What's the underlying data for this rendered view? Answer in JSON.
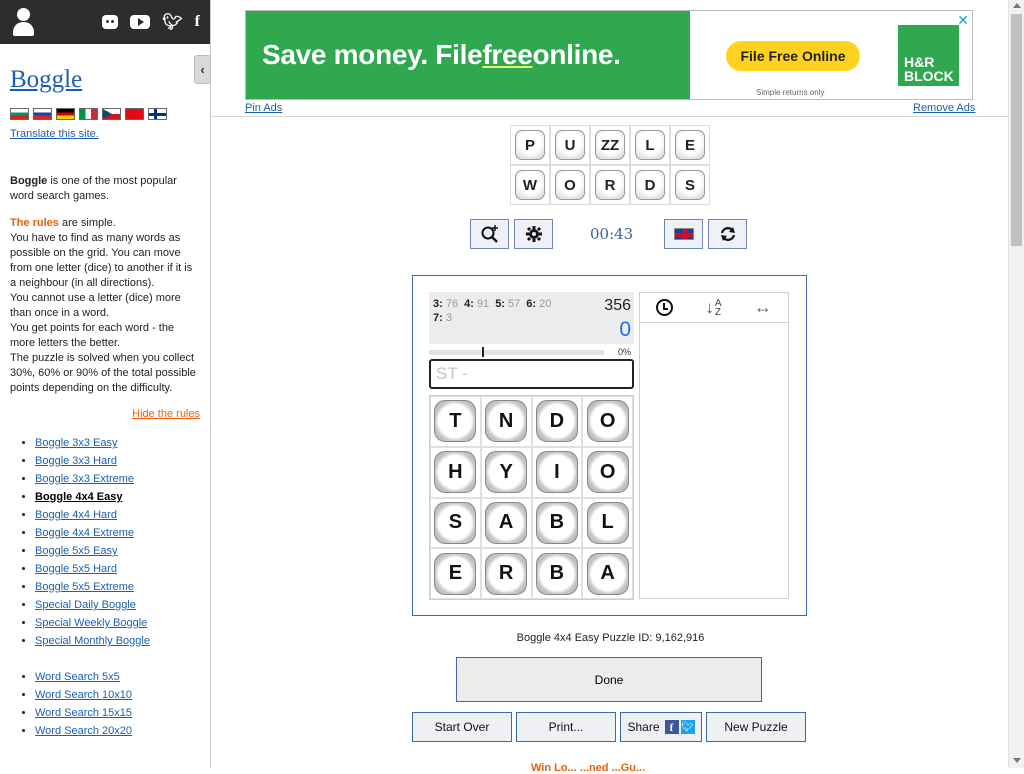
{
  "sidebar": {
    "social": [
      "user-icon",
      "discord-icon",
      "youtube-icon",
      "twitter-icon",
      "facebook-icon"
    ],
    "site_title": "Boggle",
    "flags": [
      "bg",
      "ru",
      "de",
      "it",
      "cz",
      "tr",
      "fi"
    ],
    "translate_link": "Translate this site.",
    "intro_bold": "Boggle",
    "intro_text": " is one of the most popular word search games.",
    "rules_heading": "The rules",
    "rules_text_1": " are simple.",
    "rules_body": "You have to find as many words as possible on the grid. You can move from one letter (dice) to another if it is a neighbour (in all directions).",
    "rules_body_2": "You cannot use a letter (dice) more than once in a word.",
    "rules_body_3": "You get points for each word - the more letters the better.",
    "rules_body_4": "The puzzle is solved when you collect 30%, 60% or 90% of the total possible points depending on the difficulty.",
    "hide_rules": "Hide the rules",
    "games": [
      {
        "label": "Boggle 3x3 Easy",
        "current": false
      },
      {
        "label": "Boggle 3x3 Hard",
        "current": false
      },
      {
        "label": "Boggle 3x3 Extreme",
        "current": false
      },
      {
        "label": "Boggle 4x4 Easy",
        "current": true
      },
      {
        "label": "Boggle 4x4 Hard",
        "current": false
      },
      {
        "label": "Boggle 4x4 Extreme",
        "current": false
      },
      {
        "label": "Boggle 5x5 Easy",
        "current": false
      },
      {
        "label": "Boggle 5x5 Hard",
        "current": false
      },
      {
        "label": "Boggle 5x5 Extreme",
        "current": false
      },
      {
        "label": "Special Daily Boggle",
        "current": false
      },
      {
        "label": "Special Weekly Boggle",
        "current": false
      },
      {
        "label": "Special Monthly Boggle",
        "current": false
      }
    ],
    "word_search": [
      {
        "label": "Word Search 5x5"
      },
      {
        "label": "Word Search 10x10"
      },
      {
        "label": "Word Search 15x15"
      },
      {
        "label": "Word Search 20x20"
      }
    ]
  },
  "ad": {
    "headline_1": "Save money. File ",
    "headline_free": "free",
    "headline_2": " online.",
    "cta": "File Free Online",
    "small_text": "Simple returns only",
    "brand_line_1": "H&R",
    "brand_line_2": "BLOCK",
    "close": "✕",
    "pin_ads": "Pin Ads",
    "remove_ads": "Remove Ads"
  },
  "title_tiles": [
    [
      "P",
      "U",
      "ZZ",
      "L",
      "E"
    ],
    [
      "W",
      "O",
      "R",
      "D",
      "S"
    ]
  ],
  "toolbar": {
    "hint_icon": "magnifier-plus-icon",
    "settings_icon": "gear-icon",
    "timer": "00:43",
    "language_icon": "uk-flag-icon",
    "refresh_icon": "refresh-icon"
  },
  "score": {
    "counts": [
      {
        "label": "3:",
        "value": "76"
      },
      {
        "label": "4:",
        "value": "91"
      },
      {
        "label": "5:",
        "value": "57"
      },
      {
        "label": "6:",
        "value": "20"
      },
      {
        "label": "7:",
        "value": "3"
      }
    ],
    "total_points": "356",
    "found_points": "0",
    "progress_percent": "0%",
    "target_fraction": 0.3
  },
  "input": {
    "placeholder": "ST -"
  },
  "board": [
    [
      "T",
      "N",
      "D",
      "O"
    ],
    [
      "H",
      "Y",
      "I",
      "O"
    ],
    [
      "S",
      "A",
      "B",
      "L"
    ],
    [
      "E",
      "R",
      "B",
      "A"
    ]
  ],
  "words_panel": {
    "sort_time_icon": "clock-icon",
    "sort_alpha_label_top": "A",
    "sort_alpha_label_bottom": "Z",
    "width_icon": "↔"
  },
  "puzzle_id": "Boggle 4x4 Easy Puzzle ID: 9,162,916",
  "buttons": {
    "done": "Done",
    "start_over": "Start Over",
    "print": "Print...",
    "share": "Share",
    "new_puzzle": "New Puzzle"
  },
  "footer_peek": "Win Lo...  ...ned ...Gu..."
}
